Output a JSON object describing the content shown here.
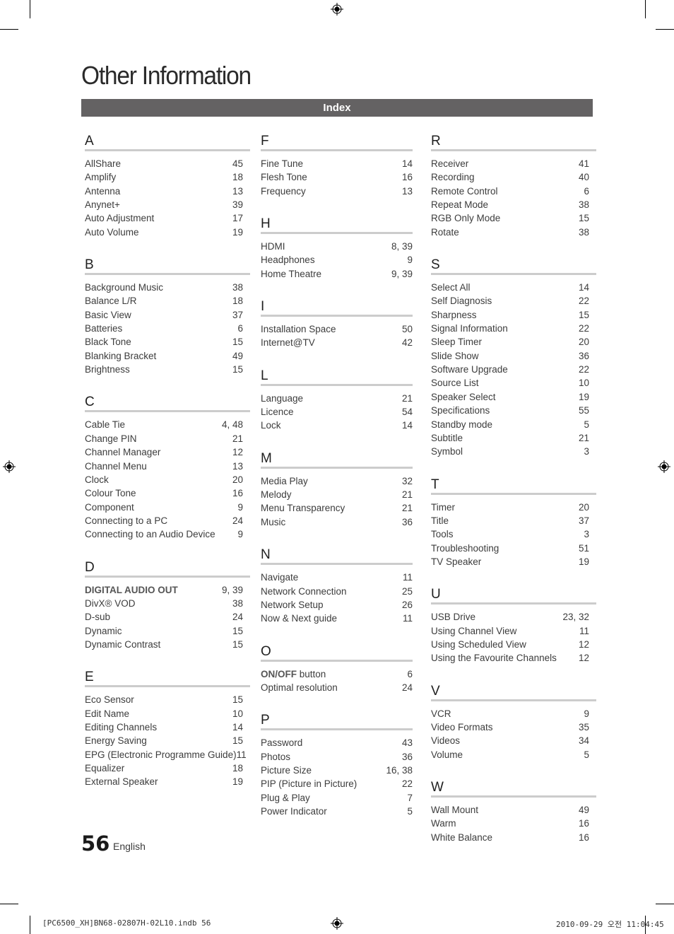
{
  "page": {
    "title": "Other Information",
    "banner": "Index",
    "page_number": "56",
    "language": "English"
  },
  "slug": {
    "file": "[PC6500_XH]BN68-02807H-02L10.indb   56",
    "timestamp": "2010-09-29   오전 11:04:45"
  },
  "columns": [
    [
      {
        "letter": "A",
        "entries": [
          {
            "term": "AllShare",
            "pages": "45"
          },
          {
            "term": "Amplify",
            "pages": "18"
          },
          {
            "term": "Antenna",
            "pages": "13"
          },
          {
            "term": "Anynet+",
            "pages": "39"
          },
          {
            "term": "Auto Adjustment",
            "pages": "17"
          },
          {
            "term": "Auto Volume",
            "pages": "19"
          }
        ]
      },
      {
        "letter": "B",
        "entries": [
          {
            "term": "Background Music",
            "pages": "38"
          },
          {
            "term": "Balance L/R",
            "pages": "18"
          },
          {
            "term": "Basic View",
            "pages": "37"
          },
          {
            "term": "Batteries",
            "pages": "6"
          },
          {
            "term": "Black Tone",
            "pages": "15"
          },
          {
            "term": "Blanking Bracket",
            "pages": "49"
          },
          {
            "term": "Brightness",
            "pages": "15"
          }
        ]
      },
      {
        "letter": "C",
        "entries": [
          {
            "term": "Cable Tie",
            "pages": "4, 48"
          },
          {
            "term": "Change PIN",
            "pages": "21"
          },
          {
            "term": "Channel Manager",
            "pages": "12"
          },
          {
            "term": "Channel Menu",
            "pages": "13"
          },
          {
            "term": "Clock",
            "pages": "20"
          },
          {
            "term": "Colour Tone",
            "pages": "16"
          },
          {
            "term": "Component",
            "pages": "9"
          },
          {
            "term": "Connecting to a PC",
            "pages": "24"
          },
          {
            "term": "Connecting to an Audio Device",
            "pages": "9"
          }
        ]
      },
      {
        "letter": "D",
        "entries": [
          {
            "term": "DIGITAL AUDIO OUT",
            "pages": "9, 39",
            "bold": "DIGITAL AUDIO OUT",
            "rest": ""
          },
          {
            "term": "DivX® VOD",
            "pages": "38"
          },
          {
            "term": "D-sub",
            "pages": "24"
          },
          {
            "term": "Dynamic",
            "pages": "15"
          },
          {
            "term": "Dynamic Contrast",
            "pages": "15"
          }
        ]
      },
      {
        "letter": "E",
        "entries": [
          {
            "term": "Eco Sensor",
            "pages": "15"
          },
          {
            "term": "Edit Name",
            "pages": "10"
          },
          {
            "term": "Editing Channels",
            "pages": "14"
          },
          {
            "term": "Energy Saving",
            "pages": "15"
          },
          {
            "term": "EPG (Electronic Programme Guide)",
            "pages": "11"
          },
          {
            "term": "Equalizer",
            "pages": "18"
          },
          {
            "term": "External Speaker",
            "pages": "19"
          }
        ]
      }
    ],
    [
      {
        "letter": "F",
        "entries": [
          {
            "term": "Fine Tune",
            "pages": "14"
          },
          {
            "term": "Flesh Tone",
            "pages": "16"
          },
          {
            "term": "Frequency",
            "pages": "13"
          }
        ]
      },
      {
        "letter": "H",
        "entries": [
          {
            "term": "HDMI",
            "pages": "8, 39"
          },
          {
            "term": "Headphones",
            "pages": "9"
          },
          {
            "term": "Home Theatre",
            "pages": "9, 39"
          }
        ]
      },
      {
        "letter": "I",
        "entries": [
          {
            "term": "Installation Space",
            "pages": "50"
          },
          {
            "term": "Internet@TV",
            "pages": "42"
          }
        ]
      },
      {
        "letter": "L",
        "entries": [
          {
            "term": "Language",
            "pages": "21"
          },
          {
            "term": "Licence",
            "pages": "54"
          },
          {
            "term": "Lock",
            "pages": "14"
          }
        ]
      },
      {
        "letter": "M",
        "entries": [
          {
            "term": "Media Play",
            "pages": "32"
          },
          {
            "term": "Melody",
            "pages": "21"
          },
          {
            "term": "Menu Transparency",
            "pages": "21"
          },
          {
            "term": "Music",
            "pages": "36"
          }
        ]
      },
      {
        "letter": "N",
        "entries": [
          {
            "term": "Navigate",
            "pages": "11"
          },
          {
            "term": "Network Connection",
            "pages": "25"
          },
          {
            "term": "Network Setup",
            "pages": "26"
          },
          {
            "term": "Now & Next guide",
            "pages": "11"
          }
        ]
      },
      {
        "letter": "O",
        "entries": [
          {
            "term": "ON/OFF button",
            "pages": "6",
            "bold": "ON/OFF",
            "rest": " button"
          },
          {
            "term": "Optimal resolution",
            "pages": "24"
          }
        ]
      },
      {
        "letter": "P",
        "entries": [
          {
            "term": "Password",
            "pages": "43"
          },
          {
            "term": "Photos",
            "pages": "36"
          },
          {
            "term": "Picture Size",
            "pages": "16, 38"
          },
          {
            "term": "PIP (Picture in Picture)",
            "pages": "22"
          },
          {
            "term": "Plug & Play",
            "pages": "7"
          },
          {
            "term": "Power Indicator",
            "pages": "5"
          }
        ]
      }
    ],
    [
      {
        "letter": "R",
        "entries": [
          {
            "term": "Receiver",
            "pages": "41"
          },
          {
            "term": "Recording",
            "pages": "40"
          },
          {
            "term": "Remote Control",
            "pages": "6"
          },
          {
            "term": "Repeat Mode",
            "pages": "38"
          },
          {
            "term": "RGB Only Mode",
            "pages": "15"
          },
          {
            "term": "Rotate",
            "pages": "38"
          }
        ]
      },
      {
        "letter": "S",
        "entries": [
          {
            "term": "Select All",
            "pages": "14"
          },
          {
            "term": "Self Diagnosis",
            "pages": "22"
          },
          {
            "term": "Sharpness",
            "pages": "15"
          },
          {
            "term": "Signal Information",
            "pages": "22"
          },
          {
            "term": "Sleep Timer",
            "pages": "20"
          },
          {
            "term": "Slide Show",
            "pages": "36"
          },
          {
            "term": "Software Upgrade",
            "pages": "22"
          },
          {
            "term": "Source List",
            "pages": "10"
          },
          {
            "term": "Speaker Select",
            "pages": "19"
          },
          {
            "term": "Specifications",
            "pages": "55"
          },
          {
            "term": "Standby mode",
            "pages": "5"
          },
          {
            "term": "Subtitle",
            "pages": "21"
          },
          {
            "term": "Symbol",
            "pages": "3"
          }
        ]
      },
      {
        "letter": "T",
        "entries": [
          {
            "term": "Timer",
            "pages": "20"
          },
          {
            "term": "Title",
            "pages": "37"
          },
          {
            "term": "Tools",
            "pages": "3"
          },
          {
            "term": "Troubleshooting",
            "pages": "51"
          },
          {
            "term": "TV Speaker",
            "pages": "19"
          }
        ]
      },
      {
        "letter": "U",
        "entries": [
          {
            "term": "USB Drive",
            "pages": "23, 32"
          },
          {
            "term": "Using Channel View",
            "pages": "11"
          },
          {
            "term": "Using Scheduled View",
            "pages": "12"
          },
          {
            "term": "Using the Favourite Channels",
            "pages": "12"
          }
        ]
      },
      {
        "letter": "V",
        "entries": [
          {
            "term": "VCR",
            "pages": "9"
          },
          {
            "term": "Video Formats",
            "pages": "35"
          },
          {
            "term": "Videos",
            "pages": "34"
          },
          {
            "term": "Volume",
            "pages": "5"
          }
        ]
      },
      {
        "letter": "W",
        "entries": [
          {
            "term": "Wall Mount",
            "pages": "49"
          },
          {
            "term": "Warm",
            "pages": "16"
          },
          {
            "term": "White Balance",
            "pages": "16"
          }
        ]
      }
    ]
  ]
}
